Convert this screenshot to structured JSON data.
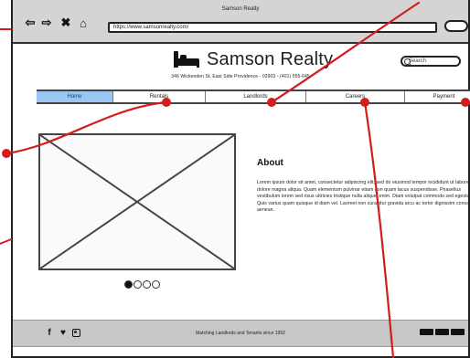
{
  "browser": {
    "title": "Samson Realty",
    "url": "https://www.samsonrealty.com/"
  },
  "header": {
    "brand_name": "Samson Realty",
    "address": "346 Wickenden St. East Side Providence - 02903 - (401) 555-645",
    "search_placeholder": "Search"
  },
  "nav": {
    "items": [
      {
        "label": "Home",
        "active": true
      },
      {
        "label": "Rentals",
        "active": false
      },
      {
        "label": "Landlords",
        "active": false
      },
      {
        "label": "Careers",
        "active": false
      },
      {
        "label": "Payment",
        "active": false
      }
    ]
  },
  "about": {
    "title": "About",
    "body": "Lorem ipsum dolor sit amet, consectetur adipiscing elit, sed do eiusmod tempor incididunt ut labore et dolore magna aliqua. Quam elementum pulvinar etiam non quam lacus suspendisse. Phasellus vestibulum lorem sed risus ultricies tristique nulla aliquet enim. Diam volutpat commodo sed egestas. Quis varius quam quisque id diam vel. Laoreet non curabitur gravida arcu ac tortor dignissim convallis aenean."
  },
  "carousel": {
    "active_index": 0,
    "count": 4
  },
  "footer": {
    "tagline": "Matching Landlords and Tenants since 1992"
  },
  "colors": {
    "nav_active": "#9cc6f2",
    "annotation_red": "#d31d1d",
    "footer_bg": "#c7c7c7"
  },
  "icons": {
    "back": "arrow-left-icon",
    "forward": "arrow-right-icon",
    "close": "close-icon",
    "home": "home-icon",
    "search": "search-icon",
    "logo": "bed-icon",
    "facebook": "facebook-icon",
    "twitter": "twitter-icon",
    "instagram": "instagram-icon"
  }
}
